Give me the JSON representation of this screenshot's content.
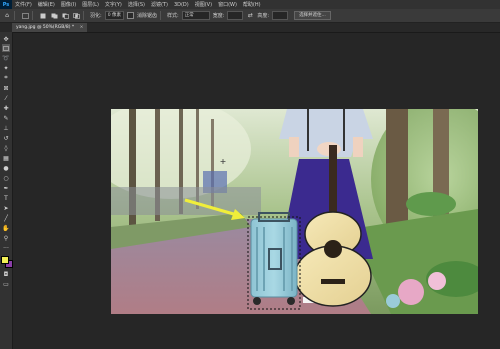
{
  "app": {
    "logo": "Ps"
  },
  "menu": [
    "文件(F)",
    "编辑(E)",
    "图像(I)",
    "图层(L)",
    "文字(Y)",
    "选择(S)",
    "滤镜(T)",
    "3D(D)",
    "视图(V)",
    "窗口(W)",
    "帮助(H)"
  ],
  "options": {
    "feather_label": "羽化:",
    "feather_value": "0 像素",
    "antialias_label": "消除锯齿",
    "style_label": "样式:",
    "style_value": "正常",
    "width_label": "宽度:",
    "height_label": "高度:",
    "select_mask_button": "选择并遮住..."
  },
  "document_tab": {
    "title": "yang.jpg @ 50%(RGB/8) *",
    "close": "×"
  },
  "colors": {
    "accent": "#31a8ff",
    "foreground": "#f2ef56",
    "background": "#8a3ea8"
  },
  "tools": [
    "move-icon",
    "marquee-icon",
    "lasso-icon",
    "magic-wand-icon",
    "crop-icon",
    "frame-icon",
    "eyedropper-icon",
    "healing-icon",
    "brush-icon",
    "stamp-icon",
    "history-brush-icon",
    "eraser-icon",
    "gradient-icon",
    "blur-icon",
    "dodge-icon",
    "pen-icon",
    "type-icon",
    "path-select-icon",
    "shape-icon",
    "hand-icon",
    "zoom-icon",
    "more-icon"
  ]
}
